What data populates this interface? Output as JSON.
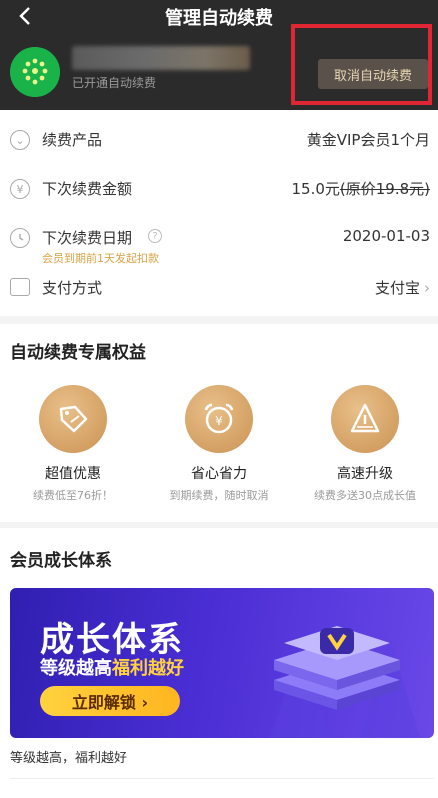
{
  "header": {
    "title": "管理自动续费",
    "back_icon": "chevron-left-icon",
    "status_text": "已开通自动续费",
    "cancel_label": "取消自动续费",
    "highlight_color": "#e02633"
  },
  "info": {
    "product": {
      "label": "续费产品",
      "value": "黄金VIP会员1个月",
      "icon": "chevron-down-circle-icon"
    },
    "amount": {
      "label": "下次续费金额",
      "value": "15.0元",
      "original": "(原价19.8元)",
      "icon": "yen-circle-icon"
    },
    "date": {
      "label": "下次续费日期",
      "value": "2020-01-03",
      "note": "会员到期前1天发起扣款",
      "icon": "clock-icon",
      "help_icon": "question-icon"
    },
    "payment": {
      "label": "支付方式",
      "value": "支付宝",
      "chevron": "›",
      "icon": "card-icon"
    }
  },
  "benefits": {
    "title": "自动续费专属权益",
    "items": [
      {
        "title": "超值优惠",
        "desc": "续费低至76折！",
        "icon": "discount-tag-icon"
      },
      {
        "title": "省心省力",
        "desc": "到期续费，随时取消",
        "icon": "alarm-clock-icon"
      },
      {
        "title": "高速升级",
        "desc": "续费多送30点成长值",
        "icon": "speed-up-icon"
      }
    ]
  },
  "growth": {
    "title": "会员成长体系",
    "banner_title": "成长体系",
    "banner_sub_prefix": "等级越高",
    "banner_sub_gold": "福利越好",
    "banner_button": "立即解锁 ›",
    "caption": "等级越高，福利越好"
  },
  "colors": {
    "header_bg": "#2b2b2b",
    "accent_gold": "#d4a063",
    "banner_purple": "#4a2ed4"
  }
}
